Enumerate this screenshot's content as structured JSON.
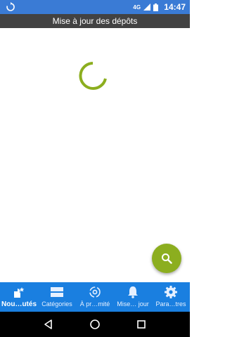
{
  "status_bar": {
    "network": "4G",
    "time": "14:47"
  },
  "title_bar": {
    "title": "Mise à jour des dépôts"
  },
  "colors": {
    "status_bar": "#3a7bd5",
    "title_bar": "#424242",
    "accent_green": "#8cae1f",
    "bottom_nav": "#1a7fe0"
  },
  "fab": {
    "icon": "search-icon"
  },
  "bottom_nav": {
    "items": [
      {
        "label": "Nou…utés",
        "icon": "new-star-icon",
        "active": true
      },
      {
        "label": "Catégories",
        "icon": "categories-icon",
        "active": false
      },
      {
        "label": "À pr…mité",
        "icon": "nearby-icon",
        "active": false
      },
      {
        "label": "Mise… jour",
        "icon": "bell-icon",
        "active": false
      },
      {
        "label": "Para…tres",
        "icon": "gear-icon",
        "active": false
      }
    ]
  },
  "system_nav": {
    "buttons": [
      "back-icon",
      "home-icon",
      "recents-icon"
    ]
  }
}
